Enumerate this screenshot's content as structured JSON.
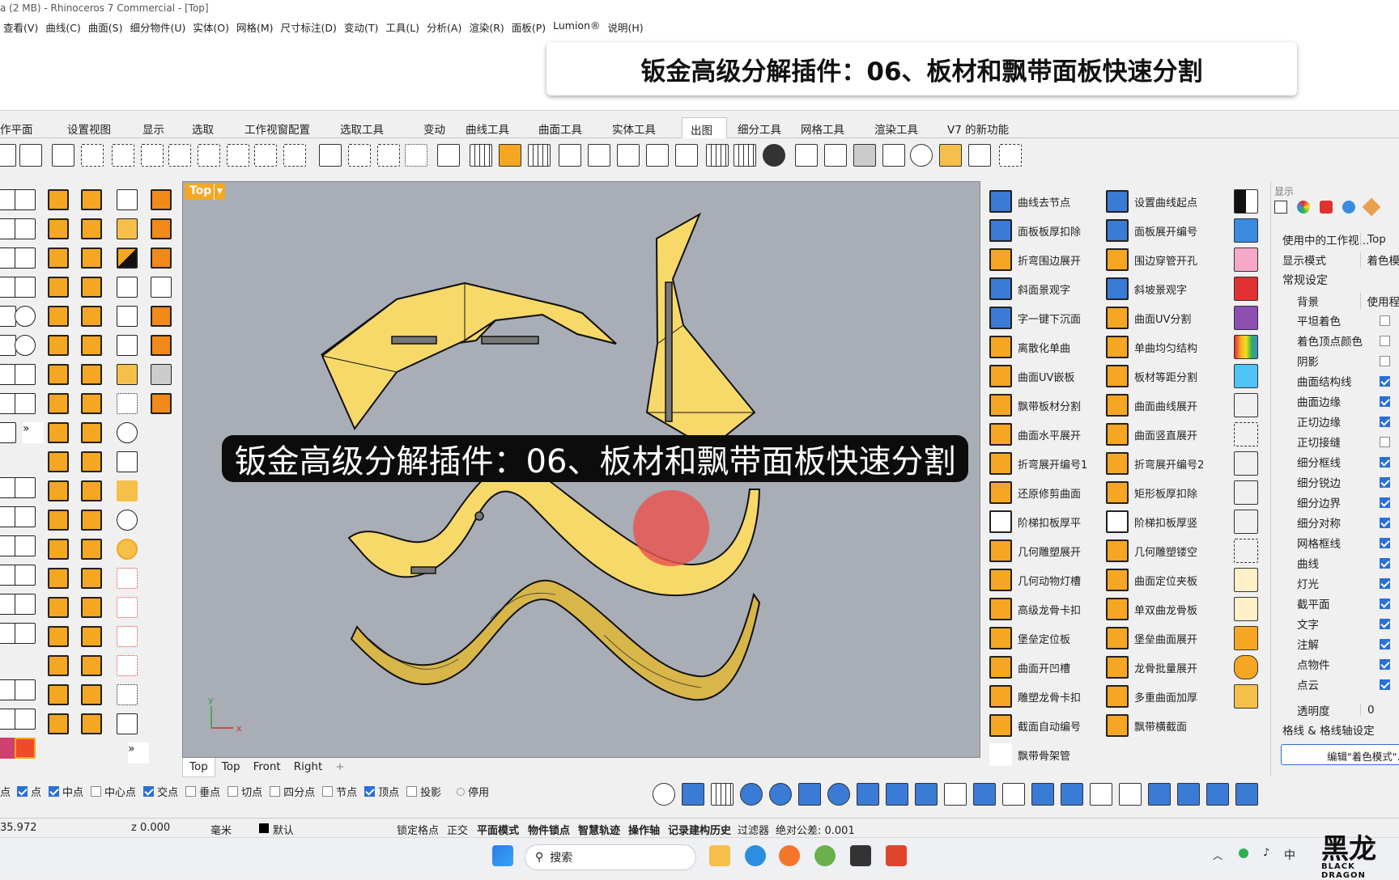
{
  "window": {
    "title": "a (2 MB) - Rhinoceros 7 Commercial - [Top]"
  },
  "menu": [
    "查看(V)",
    "曲线(C)",
    "曲面(S)",
    "细分物件(U)",
    "实体(O)",
    "网格(M)",
    "尺寸标注(D)",
    "变动(T)",
    "工具(L)",
    "分析(A)",
    "渲染(R)",
    "面板(P)",
    "Lumion®",
    "说明(H)"
  ],
  "banner": {
    "title": "钣金高级分解插件：06、板材和飘带面板快速分割"
  },
  "toolbar_tabs": {
    "items": [
      "作平面",
      "设置视图",
      "显示",
      "选取",
      "工作视窗配置",
      "选取工具",
      "变动",
      "曲线工具",
      "曲面工具",
      "实体工具",
      "出图",
      "细分工具",
      "网格工具",
      "渲染工具",
      "V7 的新功能"
    ],
    "active": "出图"
  },
  "viewport": {
    "label": "Top",
    "subtitle": "钣金高级分解插件：06、板材和飘带面板快速分割",
    "axis_x": "x",
    "axis_y": "y",
    "tabs": [
      "Top",
      "Top",
      "Front",
      "Right"
    ],
    "add_tab": "+"
  },
  "command_panel": {
    "left": [
      "曲线去节点",
      "面板板厚扣除",
      "折弯围边展开",
      "斜面景观字",
      "字一键下沉面",
      "离散化单曲",
      "曲面UV嵌板",
      "飘带板材分割",
      "曲面水平展开",
      "折弯展开编号1",
      "还原修剪曲面",
      "阶梯扣板厚平",
      "几何雕塑展开",
      "几何动物灯槽",
      "高级龙骨卡扣",
      "堡垒定位板",
      "曲面开凹槽",
      "雕塑龙骨卡扣",
      "截面自动编号",
      "飘带骨架管"
    ],
    "right": [
      "设置曲线起点",
      "面板展开编号",
      "围边穿管开孔",
      "斜坡景观字",
      "曲面UV分割",
      "单曲均匀结构",
      "板材等距分割",
      "曲面曲线展开",
      "曲面竖直展开",
      "折弯展开编号2",
      "矩形板厚扣除",
      "阶梯扣板厚竖",
      "几何雕塑镂空",
      "曲面定位夹板",
      "单双曲龙骨板",
      "堡垒曲面展开",
      "龙骨批量展开",
      "多重曲面加厚",
      "飘带横截面"
    ]
  },
  "display_panel": {
    "header": "显示",
    "viewport_label": "使用中的工作视...",
    "viewport_value": "Top",
    "mode_label": "显示模式",
    "mode_value": "着色模",
    "general_settings": "常规设定",
    "background_label": "背景",
    "background_value": "使用程",
    "options": [
      {
        "label": "平坦着色",
        "checked": false
      },
      {
        "label": "着色顶点颜色",
        "checked": false
      },
      {
        "label": "阴影",
        "checked": false
      },
      {
        "label": "曲面结构线",
        "checked": true
      },
      {
        "label": "曲面边缘",
        "checked": true
      },
      {
        "label": "正切边缘",
        "checked": true
      },
      {
        "label": "正切接缝",
        "checked": false
      },
      {
        "label": "细分框线",
        "checked": true
      },
      {
        "label": "细分锐边",
        "checked": true
      },
      {
        "label": "细分边界",
        "checked": true
      },
      {
        "label": "细分对称",
        "checked": true
      },
      {
        "label": "网格框线",
        "checked": true
      },
      {
        "label": "曲线",
        "checked": true
      },
      {
        "label": "灯光",
        "checked": true
      },
      {
        "label": "截平面",
        "checked": true
      },
      {
        "label": "文字",
        "checked": true
      },
      {
        "label": "注解",
        "checked": true
      },
      {
        "label": "点物件",
        "checked": true
      },
      {
        "label": "点云",
        "checked": true
      }
    ],
    "transparency_label": "透明度",
    "transparency_value": "0",
    "grid_settings": "格线 & 格线轴设定",
    "edit_button": "编辑\"着色模式\"..."
  },
  "snaps": [
    {
      "label": "点",
      "checked": true
    },
    {
      "label": "中点",
      "checked": true
    },
    {
      "label": "中心点",
      "checked": false
    },
    {
      "label": "交点",
      "checked": true
    },
    {
      "label": "垂点",
      "checked": false
    },
    {
      "label": "切点",
      "checked": false
    },
    {
      "label": "四分点",
      "checked": false
    },
    {
      "label": "节点",
      "checked": false
    },
    {
      "label": "顶点",
      "checked": true
    },
    {
      "label": "投影",
      "checked": false
    }
  ],
  "snaps_prefix": "点",
  "snaps_disable": "停用",
  "status": {
    "coord": "35.972",
    "z": "z 0.000",
    "unit": "毫米",
    "layer": "默认",
    "grid_snap": "锁定格点",
    "ortho": "正交",
    "planar": "平面模式",
    "osnap": "物件锁点",
    "smarttrack": "智慧轨迹",
    "gumball": "操作轴",
    "history": "记录建构历史",
    "filter": "过滤器",
    "tolerance": "绝对公差: 0.001"
  },
  "taskbar": {
    "search_placeholder": "搜索",
    "ime": "中"
  },
  "watermark": {
    "text": "黑龙",
    "sub": "BLACK DRAGON"
  },
  "colors": {
    "accent": "#f5a623",
    "panel_yellow": "#f7d96a",
    "viewport_bg": "#a9adb5",
    "checkbox": "#2b6fd8"
  }
}
